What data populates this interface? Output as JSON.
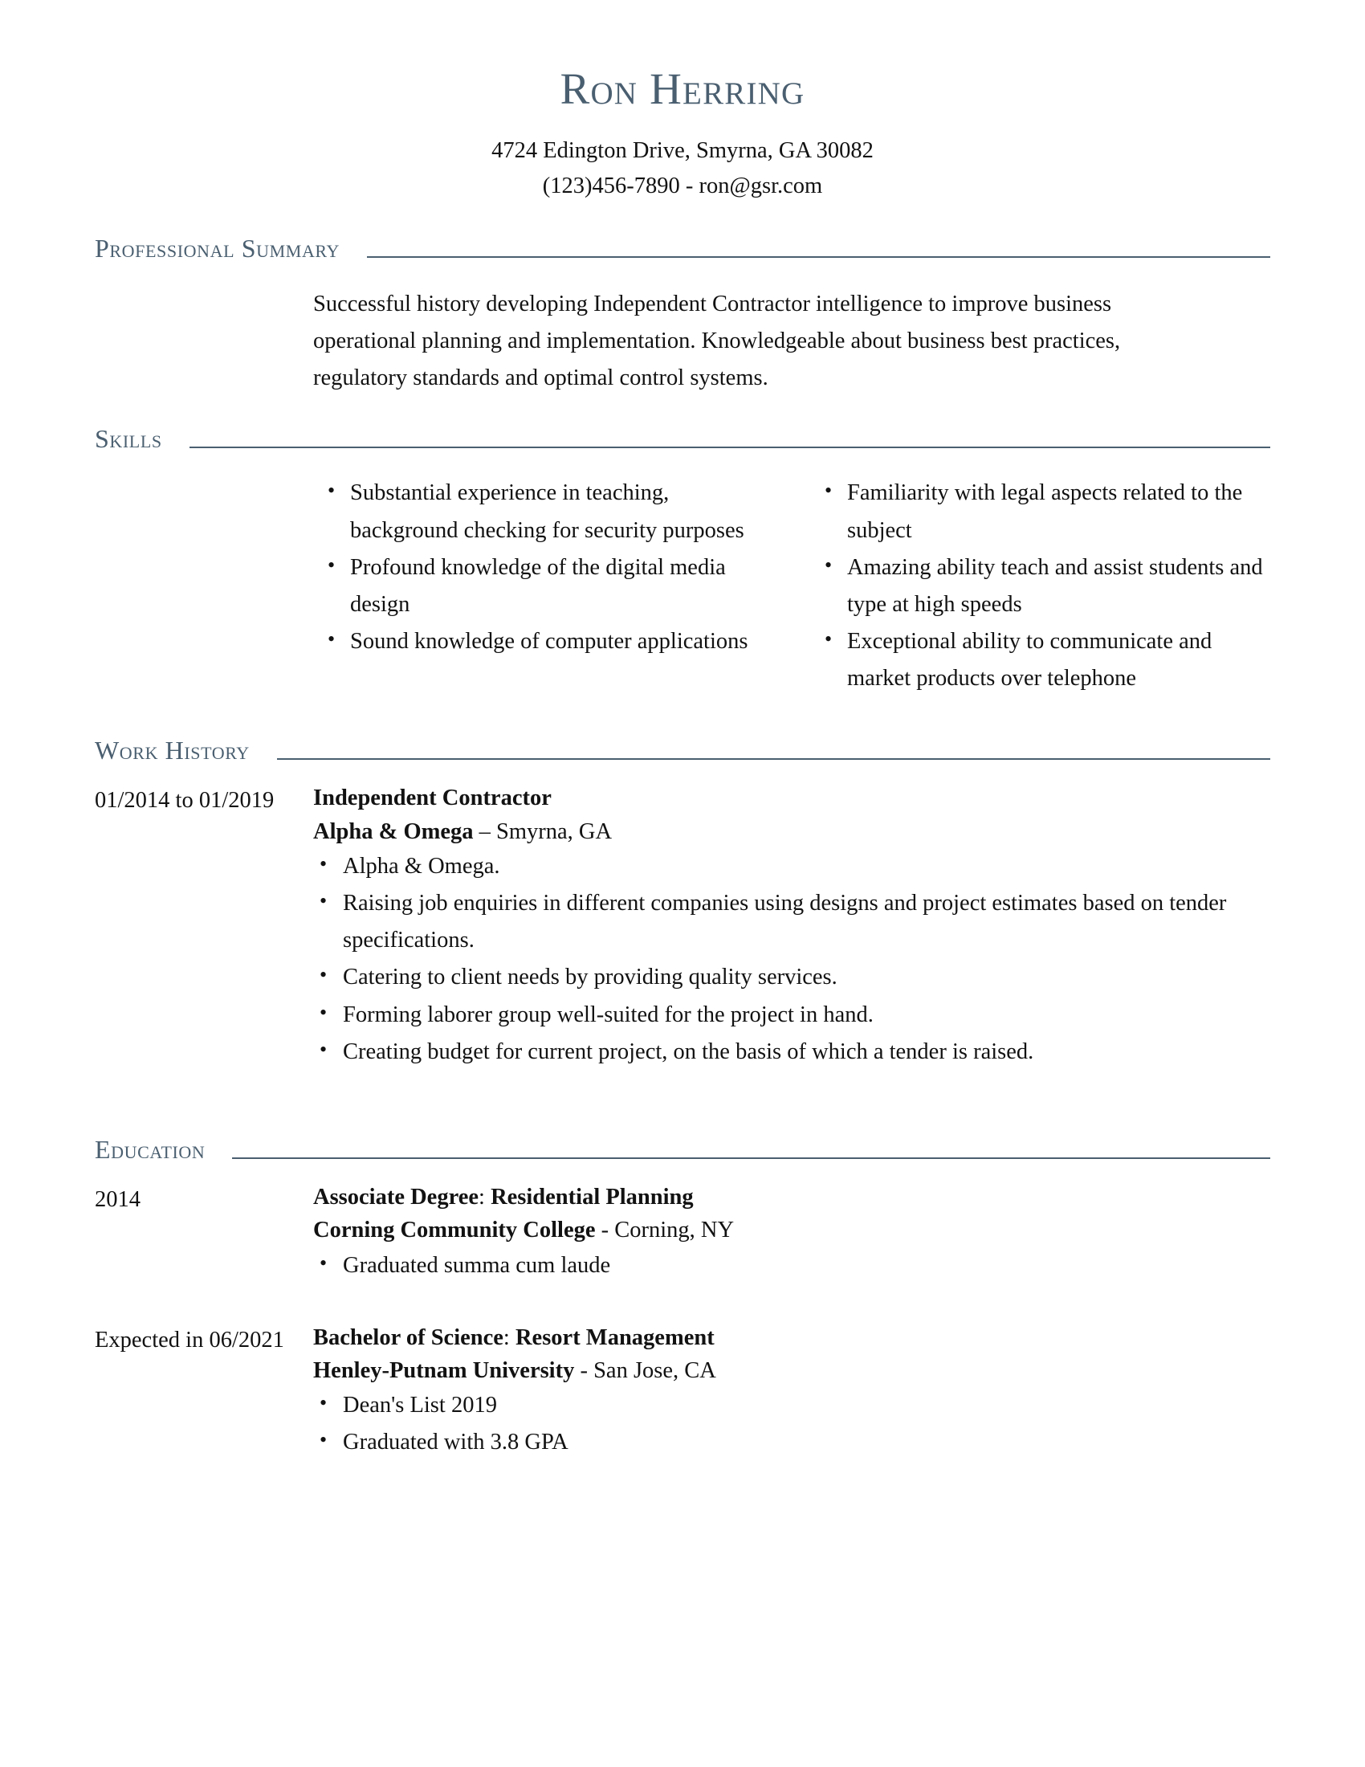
{
  "header": {
    "name": "Ron Herring",
    "address": "4724 Edington Drive, Smyrna, GA 30082",
    "phone_email": "(123)456-7890 - ron@gsr.com"
  },
  "colors": {
    "accent": "#4a5f70",
    "body_text": "#121212"
  },
  "sections": {
    "summary": {
      "title": "Professional Summary",
      "text": "Successful history developing Independent Contractor intelligence to improve business operational planning and implementation. Knowledgeable about business best practices, regulatory standards and optimal control systems."
    },
    "skills": {
      "title": "Skills",
      "column_left": [
        "Substantial experience in teaching, background checking for security purposes",
        "Profound knowledge of the digital media design",
        "Sound knowledge of computer applications"
      ],
      "column_right": [
        "Familiarity with legal aspects related to the subject",
        "Amazing ability teach and assist students and type at high speeds",
        "Exceptional ability to communicate and market products over telephone"
      ]
    },
    "work_history": {
      "title": "Work History",
      "entries": [
        {
          "dates": "01/2014 to 01/2019",
          "job_title": "Independent Contractor",
          "company": "Alpha & Omega",
          "location_sep": " – ",
          "location": "Smyrna, GA",
          "bullets": [
            "Alpha & Omega.",
            "Raising job enquiries in different companies using designs and project estimates based on tender specifications.",
            "Catering to client needs by providing quality services.",
            "Forming laborer group well-suited for the project in hand.",
            "Creating budget for current project, on the basis of which a tender is raised."
          ]
        }
      ]
    },
    "education": {
      "title": "Education",
      "entries": [
        {
          "dates": "2014",
          "degree": "Associate Degree",
          "degree_sep": ": ",
          "major": "Residential Planning",
          "school": "Corning Community College",
          "location_sep": " - ",
          "location": "Corning, NY",
          "bullets": [
            "Graduated summa cum laude"
          ]
        },
        {
          "dates": "Expected in 06/2021",
          "degree": "Bachelor of Science",
          "degree_sep": ": ",
          "major": "Resort Management",
          "school": "Henley-Putnam University",
          "location_sep": " - ",
          "location": "San Jose, CA",
          "bullets": [
            "Dean's List 2019",
            "Graduated with 3.8 GPA"
          ]
        }
      ]
    }
  }
}
